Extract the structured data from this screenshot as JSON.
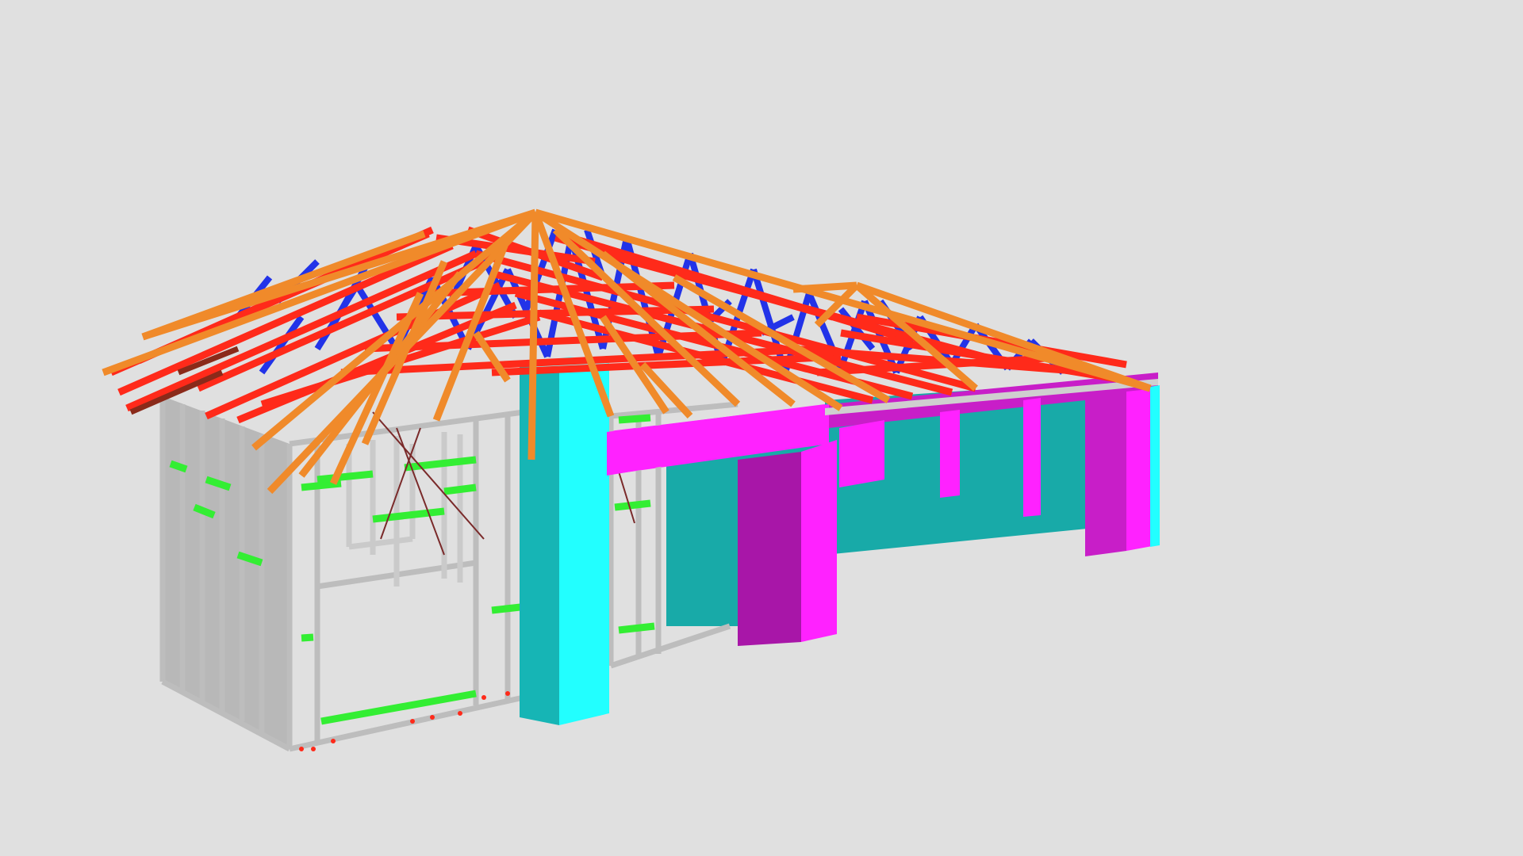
{
  "viewer": {
    "background_color": "#e0e0e0",
    "model_subject": "steel-frame-house-3d-model"
  },
  "palette": {
    "roof_truss_chord": "#ff2a1a",
    "roof_truss_web": "#2233e8",
    "rafter": "#f08a2a",
    "wall_frame": "#c8c8c8",
    "wall_frame_shadow": "#8a8a8a",
    "noggin": "#33ee33",
    "column_cyan": "#22ffff",
    "column_cyan_side": "#16b5b5",
    "beam_magenta": "#ff22ff",
    "beam_magenta_side": "#a816a8",
    "wall_panel_teal": "#18aaa8",
    "brace_dark": "#7a2a2a"
  }
}
